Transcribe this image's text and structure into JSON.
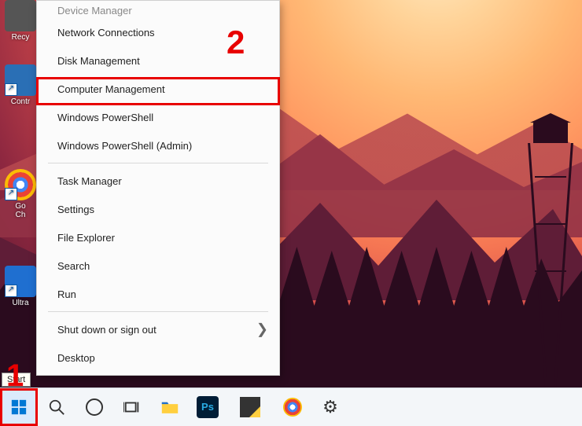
{
  "annotations": {
    "step1": "1",
    "step2": "2"
  },
  "tooltip": {
    "start": "Start"
  },
  "desktop_icons": {
    "recycle": "Recy",
    "control_panel": "Contr",
    "chrome_line1": "Go",
    "chrome_line2": "Ch",
    "ultra": "Ultra"
  },
  "menu": {
    "items": [
      {
        "label": "Device Manager"
      },
      {
        "label": "Network Connections"
      },
      {
        "label": "Disk Management"
      },
      {
        "label": "Computer Management",
        "highlighted": true
      },
      {
        "label": "Windows PowerShell"
      },
      {
        "label": "Windows PowerShell (Admin)"
      }
    ],
    "items2": [
      {
        "label": "Task Manager"
      },
      {
        "label": "Settings"
      },
      {
        "label": "File Explorer"
      },
      {
        "label": "Search"
      },
      {
        "label": "Run"
      }
    ],
    "items3": [
      {
        "label": "Shut down or sign out",
        "has_submenu": true
      },
      {
        "label": "Desktop"
      }
    ]
  },
  "taskbar": {
    "start": "start-icon",
    "search": "search-icon",
    "cortana": "cortana-icon",
    "taskview": "task-view-icon",
    "file_explorer": "file-explorer-icon",
    "photoshop": "Ps",
    "sticky": "sticky-notes-icon",
    "chrome": "chrome-icon",
    "settings": "settings-icon"
  },
  "colors": {
    "highlight": "#e80000",
    "taskbar": "#f3f6f9",
    "menu_bg": "#fbfbfb"
  }
}
